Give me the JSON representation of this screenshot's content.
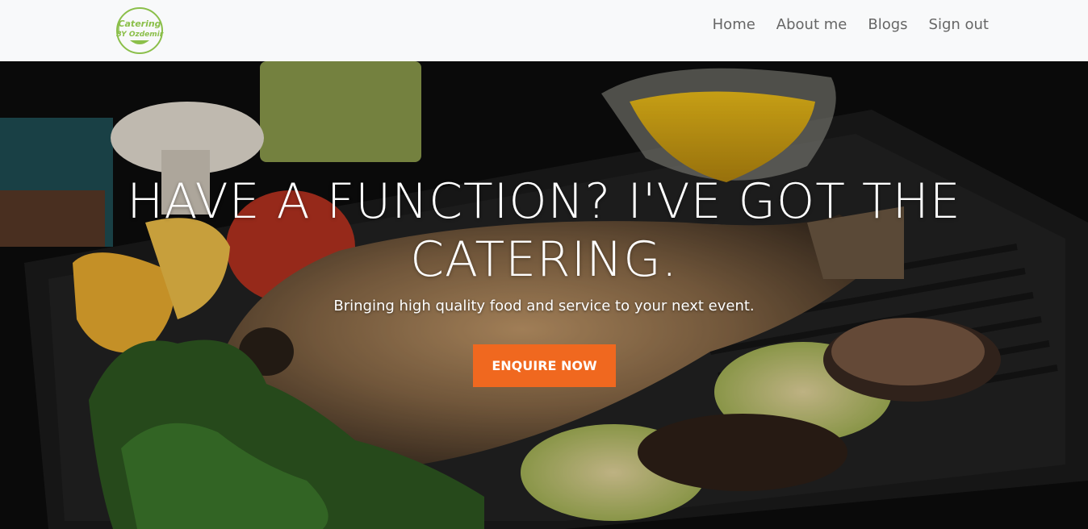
{
  "brand": {
    "logo_line1": "Catering",
    "logo_line2": "BY Ozdemir",
    "logo_color": "#8bbf4a"
  },
  "nav": {
    "items": [
      {
        "label": "Home"
      },
      {
        "label": "About me"
      },
      {
        "label": "Blogs"
      },
      {
        "label": "Sign out"
      }
    ]
  },
  "hero": {
    "title": "HAVE A FUNCTION? I'VE GOT THE CATERING.",
    "subtitle": "Bringing high quality food and service to your next event.",
    "cta_label": "ENQUIRE NOW",
    "cta_color": "#f0681f",
    "background_image": "grilled-fish-platter-photo"
  },
  "colors": {
    "navbar_bg": "#f8f9fa",
    "nav_text": "#666666",
    "hero_text": "#ffffff"
  }
}
